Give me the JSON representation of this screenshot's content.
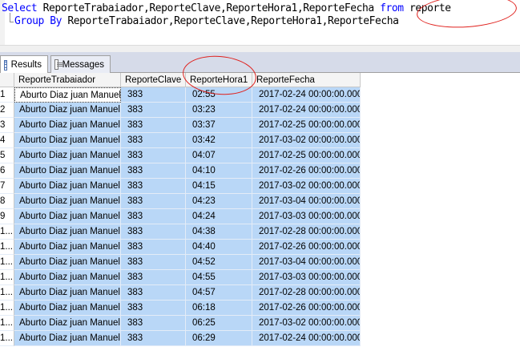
{
  "editor": {
    "line1": {
      "keyword": "Select",
      "columns": " ReporteTrabaiador,ReporteClave,ReporteHora1,ReporteFecha ",
      "from_keyword": "from",
      "table": " reporte"
    },
    "line2": {
      "keyword": "Group By",
      "columns": " ReporteTrabaiador,ReporteClave,ReporteHora1,ReporteFecha"
    }
  },
  "tabs": [
    {
      "label": "Results",
      "icon": "grid-icon",
      "active": true
    },
    {
      "label": "Messages",
      "icon": "messages-icon",
      "active": false
    }
  ],
  "grid": {
    "columns": [
      "ReporteTrabaiador",
      "ReporteClave",
      "ReporteHora1",
      "ReporteFecha"
    ],
    "rows": [
      {
        "num": "1",
        "cells": [
          "Aburto Diaz juan Manuel",
          "383",
          "02:55",
          "2017-02-24 00:00:00.000"
        ]
      },
      {
        "num": "2",
        "cells": [
          "Aburto Diaz juan Manuel",
          "383",
          "03:23",
          "2017-02-24 00:00:00.000"
        ]
      },
      {
        "num": "3",
        "cells": [
          "Aburto Diaz juan Manuel",
          "383",
          "03:37",
          "2017-02-25 00:00:00.000"
        ]
      },
      {
        "num": "4",
        "cells": [
          "Aburto Diaz juan Manuel",
          "383",
          "03:42",
          "2017-03-02 00:00:00.000"
        ]
      },
      {
        "num": "5",
        "cells": [
          "Aburto Diaz juan Manuel",
          "383",
          "04:07",
          "2017-02-25 00:00:00.000"
        ]
      },
      {
        "num": "6",
        "cells": [
          "Aburto Diaz juan Manuel",
          "383",
          "04:10",
          "2017-02-26 00:00:00.000"
        ]
      },
      {
        "num": "7",
        "cells": [
          "Aburto Diaz juan Manuel",
          "383",
          "04:15",
          "2017-03-02 00:00:00.000"
        ]
      },
      {
        "num": "8",
        "cells": [
          "Aburto Diaz juan Manuel",
          "383",
          "04:23",
          "2017-03-04 00:00:00.000"
        ]
      },
      {
        "num": "9",
        "cells": [
          "Aburto Diaz juan Manuel",
          "383",
          "04:24",
          "2017-03-03 00:00:00.000"
        ]
      },
      {
        "num": "1...",
        "cells": [
          "Aburto Diaz juan Manuel",
          "383",
          "04:38",
          "2017-02-28 00:00:00.000"
        ]
      },
      {
        "num": "1...",
        "cells": [
          "Aburto Diaz juan Manuel",
          "383",
          "04:40",
          "2017-02-26 00:00:00.000"
        ]
      },
      {
        "num": "1...",
        "cells": [
          "Aburto Diaz juan Manuel",
          "383",
          "04:52",
          "2017-03-04 00:00:00.000"
        ]
      },
      {
        "num": "1...",
        "cells": [
          "Aburto Diaz juan Manuel",
          "383",
          "04:55",
          "2017-03-03 00:00:00.000"
        ]
      },
      {
        "num": "1...",
        "cells": [
          "Aburto Diaz juan Manuel",
          "383",
          "04:57",
          "2017-02-28 00:00:00.000"
        ]
      },
      {
        "num": "1...",
        "cells": [
          "Aburto Diaz juan Manuel",
          "383",
          "06:18",
          "2017-02-26 00:00:00.000"
        ]
      },
      {
        "num": "1...",
        "cells": [
          "Aburto Diaz juan Manuel",
          "383",
          "06:25",
          "2017-03-02 00:00:00.000"
        ]
      },
      {
        "num": "1...",
        "cells": [
          "Aburto Diaz juan Manuel",
          "383",
          "06:29",
          "2017-02-24 00:00:00.000"
        ]
      }
    ]
  },
  "colors": {
    "keyword": "#0000ff",
    "selection": "#b9d7f7",
    "annotation": "#e0201c"
  }
}
